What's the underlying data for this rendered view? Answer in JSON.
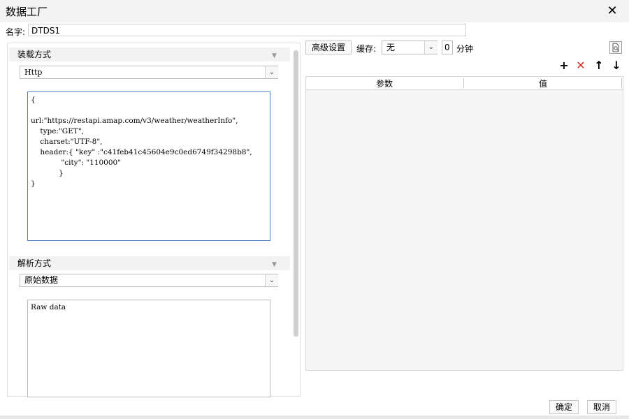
{
  "window": {
    "title": "数据工厂",
    "close_glyph": "✕"
  },
  "name": {
    "label": "名字:",
    "value": "DTDS1"
  },
  "load_section": {
    "header": "装载方式",
    "select_value": "Http",
    "code": "{\n\nurl:\"https://restapi.amap.com/v3/weather/weatherInfo\",\n    type:\"GET\",\n    charset:\"UTF-8\",\n    header:{ \"key\" :\"c41feb41c45604e9c0ed6749f34298b8\",\n             \"city\": \"110000\"\n            }\n}"
  },
  "parse_section": {
    "header": "解析方式",
    "select_value": "原始数据",
    "content": "Raw data"
  },
  "toolbar": {
    "advanced_label": "高级设置",
    "cache_label": "缓存:",
    "cache_value": "无",
    "minutes_value": "0",
    "minutes_unit": "分钟"
  },
  "table": {
    "columns": [
      "参数",
      "值"
    ],
    "actions": {
      "add": "+",
      "delete": "✕",
      "up": "↑",
      "down": "↓"
    }
  },
  "footer": {
    "ok_label": "确定",
    "cancel_label": "取消"
  },
  "colors": {
    "delete_red": "#d93025",
    "code_border": "#4a7fc8"
  }
}
